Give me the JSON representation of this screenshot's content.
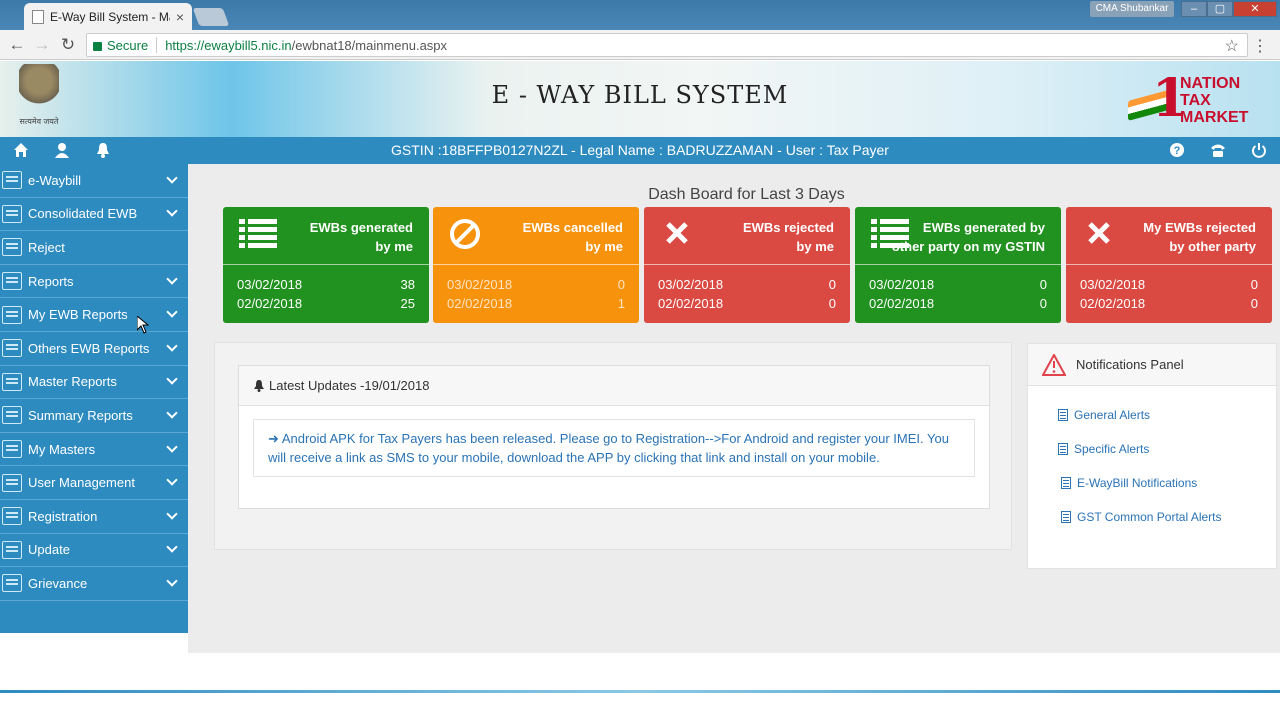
{
  "browser": {
    "tab_title": "E-Way Bill System - Main",
    "tab_close": "×",
    "profile_name": "CMA Shubankar",
    "window_minimize": "–",
    "window_restore": "▢",
    "window_close": "✕",
    "secure_label": "Secure",
    "url_host": "https://ewaybill5.nic.in",
    "url_path": "/ewbnat18/mainmenu.aspx",
    "back_icon": "←",
    "forward_icon": "→",
    "reload_icon": "↻",
    "star_icon": "☆",
    "menu_icon": "⋮"
  },
  "header": {
    "emblem_text": "सत्यमेव जयते",
    "title": "E - WAY BILL SYSTEM",
    "gst_logo_lines": [
      "NATION",
      "TAX",
      "MARKET"
    ],
    "gst_logo_number": "1"
  },
  "subbar": {
    "info": "GSTIN :18BFFPB0127N2ZL - Legal Name : BADRUZZAMAN - User : Tax Payer",
    "home_icon": "home-icon",
    "user_icon": "user-icon",
    "bell_icon": "bell-icon",
    "help_icon": "help-icon",
    "phone_icon": "phone-icon",
    "power_icon": "power-icon"
  },
  "sidebar": {
    "items": [
      {
        "label": "e-Waybill",
        "has_children": true
      },
      {
        "label": "Consolidated EWB",
        "has_children": true
      },
      {
        "label": "Reject",
        "has_children": false
      },
      {
        "label": "Reports",
        "has_children": true
      },
      {
        "label": "My EWB Reports",
        "has_children": true
      },
      {
        "label": "Others EWB Reports",
        "has_children": true
      },
      {
        "label": "Master Reports",
        "has_children": true
      },
      {
        "label": "Summary Reports",
        "has_children": true
      },
      {
        "label": "My Masters",
        "has_children": true
      },
      {
        "label": "User Management",
        "has_children": true
      },
      {
        "label": "Registration",
        "has_children": true
      },
      {
        "label": "Update",
        "has_children": true
      },
      {
        "label": "Grievance",
        "has_children": true
      }
    ]
  },
  "dashboard": {
    "title": "Dash Board for Last 3 Days",
    "cards": [
      {
        "title_line1": "EWBs generated",
        "title_line2": "by me",
        "icon": "list-icon",
        "color": "#21911f",
        "rows": [
          {
            "date": "03/02/2018",
            "count": "38"
          },
          {
            "date": "02/02/2018",
            "count": "25"
          }
        ]
      },
      {
        "title_line1": "EWBs cancelled",
        "title_line2": "by me",
        "icon": "ban-icon",
        "color": "#f7920c",
        "rows": [
          {
            "date": "03/02/2018",
            "count": "0"
          },
          {
            "date": "02/02/2018",
            "count": "1"
          }
        ]
      },
      {
        "title_line1": "EWBs rejected",
        "title_line2": "by me",
        "icon": "x-icon",
        "color": "#da4a43",
        "rows": [
          {
            "date": "03/02/2018",
            "count": "0"
          },
          {
            "date": "02/02/2018",
            "count": "0"
          }
        ]
      },
      {
        "title_line1": "EWBs generated by",
        "title_line2": "other party on my GSTIN",
        "icon": "list-icon",
        "color": "#21911f",
        "rows": [
          {
            "date": "03/02/2018",
            "count": "0"
          },
          {
            "date": "02/02/2018",
            "count": "0"
          }
        ]
      },
      {
        "title_line1": "My EWBs rejected",
        "title_line2": "by other party",
        "icon": "x-icon",
        "color": "#da4a43",
        "rows": [
          {
            "date": "03/02/2018",
            "count": "0"
          },
          {
            "date": "02/02/2018",
            "count": "0"
          }
        ]
      }
    ]
  },
  "updates": {
    "heading": "Latest Updates -19/01/2018",
    "message": "Android APK for Tax Payers has been released. Please go to Registration-->For Android and register your IMEI. You will receive a link as SMS to your mobile, download the APP by clicking that link and install on your mobile.",
    "arrow": "➜"
  },
  "notifications": {
    "heading": "Notifications Panel",
    "items": [
      "General Alerts",
      "Specific Alerts",
      "E-WayBill Notifications",
      "GST Common Portal Alerts"
    ]
  }
}
